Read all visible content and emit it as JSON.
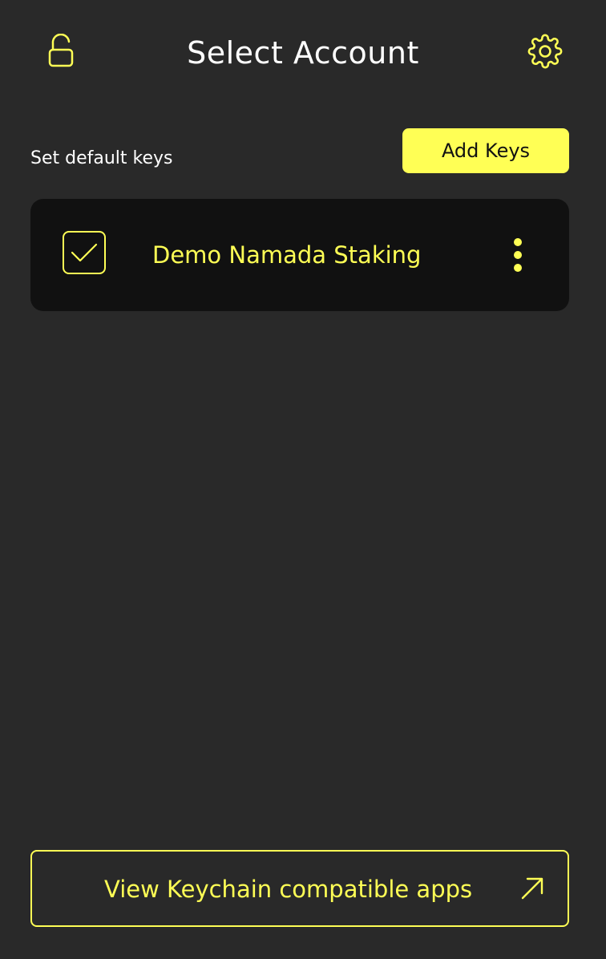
{
  "header": {
    "title": "Select Account",
    "lock_icon": "unlocked-padlock-icon",
    "settings_icon": "gear-icon"
  },
  "toolbar": {
    "subtitle": "Set default keys",
    "add_keys_label": "Add Keys"
  },
  "accounts": [
    {
      "name": "Demo Namada Staking",
      "checked": true,
      "menu_icon": "vertical-ellipsis-icon"
    }
  ],
  "footer": {
    "view_apps_label": "View Keychain compatible apps",
    "arrow_icon": "external-arrow-icon"
  },
  "colors": {
    "background": "#292929",
    "accent": "#ffff55",
    "card": "#111111",
    "text": "#ffffff"
  }
}
